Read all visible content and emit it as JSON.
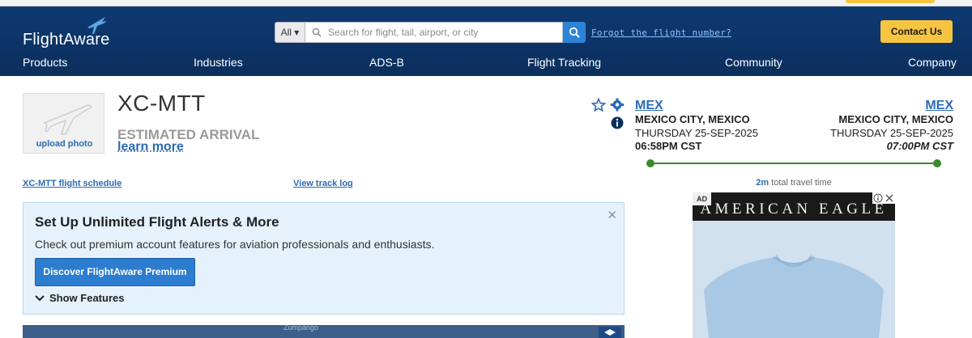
{
  "header": {
    "logo_text": "FlightAware",
    "search": {
      "scope": "All ▾",
      "placeholder": "Search for flight, tail, airport, or city"
    },
    "forgot_link": "Forgot the flight number?",
    "contact_button": "Contact Us",
    "nav": [
      "Products",
      "Industries",
      "ADS-B",
      "Flight Tracking",
      "Community",
      "Company"
    ]
  },
  "aircraft": {
    "upload_label": "upload photo",
    "tail": "XC-MTT",
    "status": "ESTIMATED ARRIVAL",
    "learn_more": "learn more",
    "schedule_link": "XC-MTT flight schedule",
    "track_log_link": "View track log"
  },
  "route": {
    "origin": {
      "code": "MEX",
      "city": "MEXICO CITY, MEXICO",
      "date": "THURSDAY 25-SEP-2025",
      "time": "06:58PM CST"
    },
    "destination": {
      "code": "MEX",
      "city": "MEXICO CITY, MEXICO",
      "date": "THURSDAY 25-SEP-2025",
      "time": "07:00PM CST"
    },
    "duration": "2m",
    "duration_suffix": " total travel time"
  },
  "promo": {
    "title": "Set Up Unlimited Flight Alerts & More",
    "subtitle": "Check out premium account features for aviation professionals and enthusiasts.",
    "button": "Discover FlightAware Premium",
    "show_features": "Show Features",
    "close": "✕"
  },
  "map": {
    "place": "Zumpango"
  },
  "ad": {
    "label": "AD",
    "brand": "AMERICAN EAGLE"
  },
  "colors": {
    "header_bg": "#0e3a72",
    "link": "#2c6bb3",
    "accent_button": "#f7c442",
    "track_green": "#3a8a2c",
    "promo_bg": "#e6f2fb"
  },
  "icons": [
    "search-icon",
    "plane-icon",
    "star-icon",
    "gear-icon",
    "info-icon",
    "chevron-down-icon",
    "close-icon",
    "layers-icon",
    "ad-choices-icon"
  ]
}
